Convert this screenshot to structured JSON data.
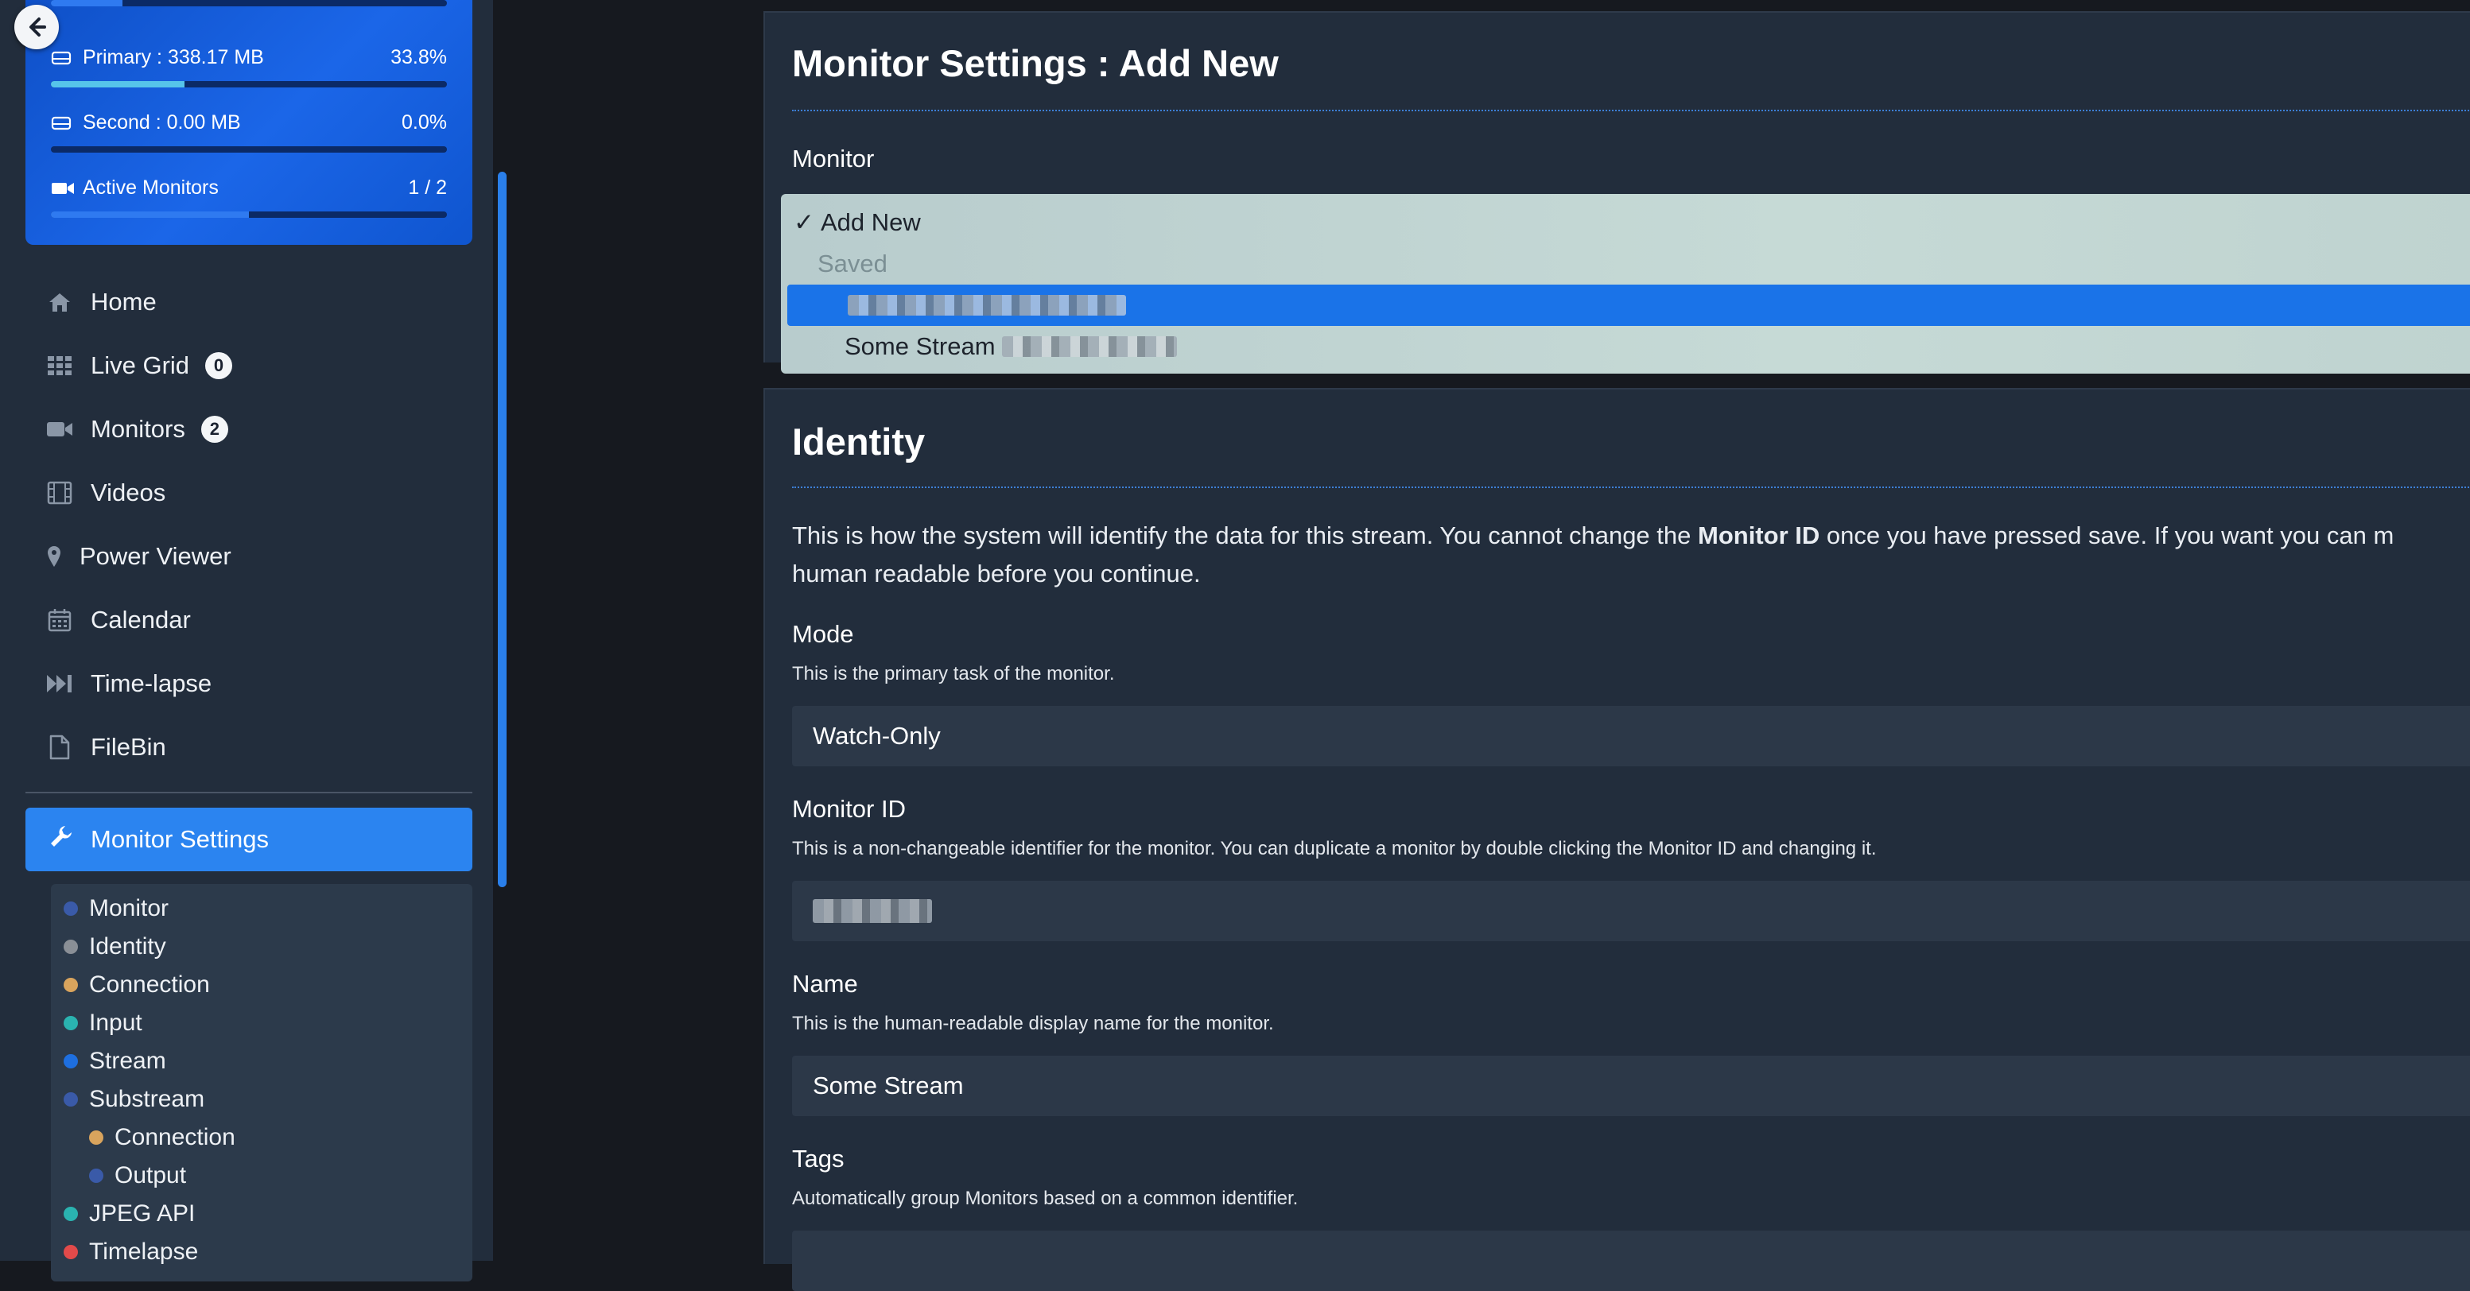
{
  "stats": {
    "primary": {
      "label": "Primary : 338.17 MB",
      "percent": "33.8%",
      "fill": 0.338
    },
    "second": {
      "label": "Second : 0.00 MB",
      "percent": "0.0%",
      "fill": 0.0
    },
    "monitors": {
      "label": "Active Monitors",
      "value": "1 / 2",
      "fill": 0.5
    },
    "top_bar_fill": 0.18
  },
  "nav": [
    {
      "label": "Home",
      "icon": "home-icon"
    },
    {
      "label": "Live Grid",
      "icon": "grid-icon",
      "badge": "0"
    },
    {
      "label": "Monitors",
      "icon": "video-camera-icon",
      "badge": "2"
    },
    {
      "label": "Videos",
      "icon": "film-icon"
    },
    {
      "label": "Power Viewer",
      "icon": "map-pin-icon"
    },
    {
      "label": "Calendar",
      "icon": "calendar-icon"
    },
    {
      "label": "Time-lapse",
      "icon": "fast-forward-icon"
    },
    {
      "label": "FileBin",
      "icon": "file-icon"
    }
  ],
  "monitor_settings": {
    "label": "Monitor Settings",
    "icon": "wrench-icon"
  },
  "subnav": [
    {
      "label": "Monitor",
      "color": "#3a5aa8"
    },
    {
      "label": "Identity",
      "color": "#8a8f96"
    },
    {
      "label": "Connection",
      "color": "#d9a45d"
    },
    {
      "label": "Input",
      "color": "#2ab3b0"
    },
    {
      "label": "Stream",
      "color": "#1e6fe0"
    },
    {
      "label": "Substream",
      "color": "#3a5aa8"
    },
    {
      "label": "Connection",
      "color": "#d9a45d"
    },
    {
      "label": "Output",
      "color": "#3a5aa8"
    },
    {
      "label": "JPEG API",
      "color": "#2ab3b0"
    },
    {
      "label": "Timelapse",
      "color": "#e24a4a"
    }
  ],
  "panel1": {
    "title": "Monitor Settings : Add New",
    "monitor_label": "Monitor",
    "options": {
      "check": "✓",
      "add_new": "Add New",
      "group": "Saved",
      "second_item": "Some Stream"
    }
  },
  "identity": {
    "title": "Identity",
    "intro_1": "This is how the system will identify the data for this stream. You cannot change the ",
    "intro_bold": "Monitor ID",
    "intro_2": " once you have pressed save. If you want you can m",
    "intro_line2": "human readable before you continue.",
    "mode": {
      "label": "Mode",
      "desc": "This is the primary task of the monitor.",
      "value": "Watch-Only"
    },
    "monitor_id": {
      "label": "Monitor ID",
      "desc": "This is a non-changeable identifier for the monitor. You can duplicate a monitor by double clicking the Monitor ID and changing it."
    },
    "name": {
      "label": "Name",
      "desc": "This is the human-readable display name for the monitor.",
      "value": "Some Stream"
    },
    "tags": {
      "label": "Tags",
      "desc": "Automatically group Monitors based on a common identifier."
    }
  }
}
